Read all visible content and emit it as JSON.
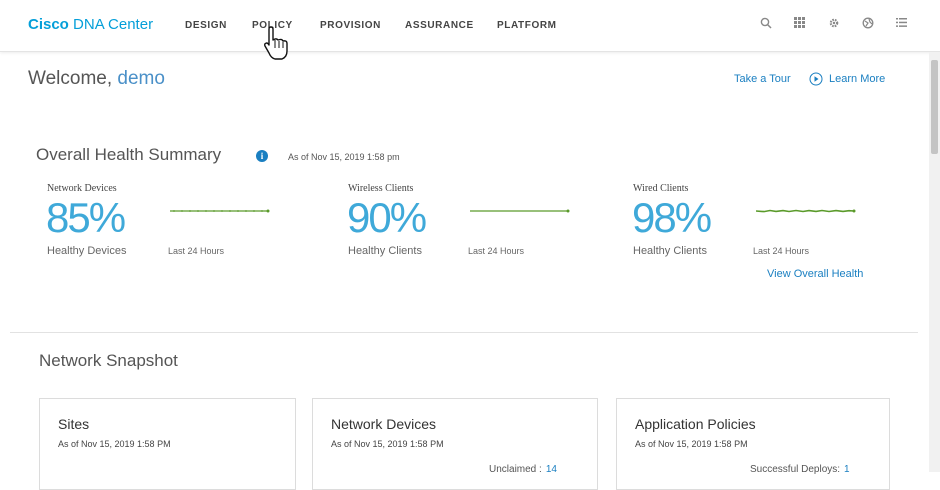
{
  "brand": {
    "bold": "Cisco",
    "rest": "DNA Center"
  },
  "nav": [
    {
      "label": "DESIGN"
    },
    {
      "label": "POLICY"
    },
    {
      "label": "PROVISION"
    },
    {
      "label": "ASSURANCE"
    },
    {
      "label": "PLATFORM"
    }
  ],
  "toolbar_icons": [
    "search-icon",
    "apps-grid-icon",
    "gear-icon",
    "globe-icon",
    "menu-list-icon"
  ],
  "welcome": {
    "prefix": "Welcome,",
    "user": "demo"
  },
  "links": {
    "tour": "Take a Tour",
    "learn_more": "Learn More",
    "view_overall_health": "View Overall Health"
  },
  "health": {
    "title": "Overall Health Summary",
    "as_of": "As of Nov 15, 2019 1:58 pm",
    "metrics": [
      {
        "label": "Network Devices",
        "percent": "85%",
        "sub": "Healthy Devices",
        "period": "Last 24 Hours"
      },
      {
        "label": "Wireless Clients",
        "percent": "90%",
        "sub": "Healthy Clients",
        "period": "Last 24 Hours"
      },
      {
        "label": "Wired Clients",
        "percent": "98%",
        "sub": "Healthy Clients",
        "period": "Last 24 Hours"
      }
    ]
  },
  "snapshot": {
    "title": "Network Snapshot",
    "cards": [
      {
        "title": "Sites",
        "as_of": "As of Nov 15, 2019 1:58 PM"
      },
      {
        "title": "Network Devices",
        "as_of": "As of Nov 15, 2019 1:58 PM",
        "stat_label": "Unclaimed :",
        "stat_value": "14"
      },
      {
        "title": "Application Policies",
        "as_of": "As of Nov 15, 2019 1:58 PM",
        "stat_label": "Successful Deploys:",
        "stat_value": "1"
      }
    ]
  },
  "colors": {
    "brand": "#049fd9",
    "accent": "#1a7fc1",
    "percent": "#3fa9d9",
    "spark": "#5a9a2a"
  }
}
